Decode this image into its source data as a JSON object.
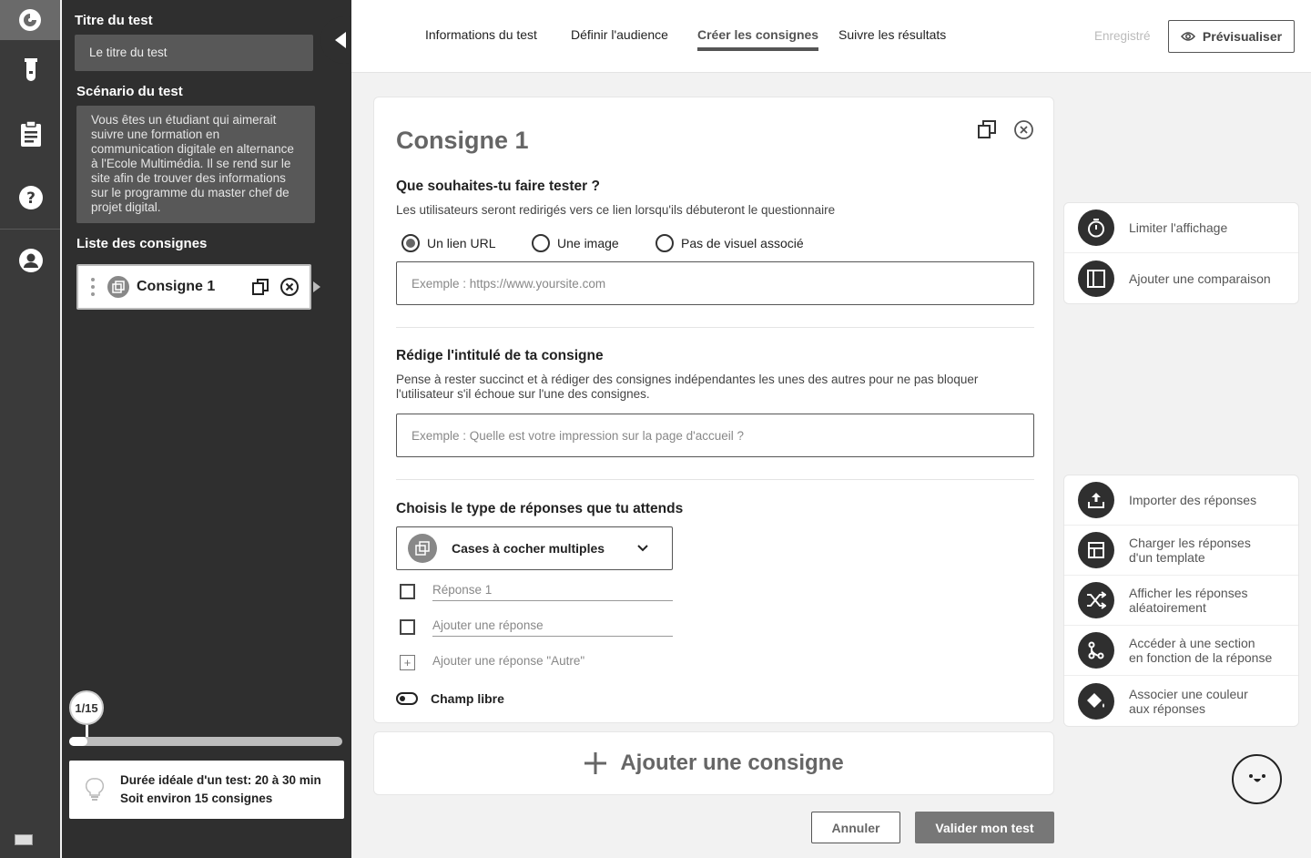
{
  "sidebar": {
    "test_title_heading": "Titre du test",
    "test_title_value": "Le titre du test",
    "scenario_heading": "Scénario du test",
    "scenario_text": "Vous êtes un étudiant qui aimerait suivre une formation en communication digitale en alternance à l'Ecole Multimédia. Il se rend sur le site afin de trouver des informations sur le programme du master chef de projet digital.",
    "list_heading": "Liste des consignes",
    "consignes": [
      {
        "label": "Consigne 1"
      }
    ],
    "progress_label": "1/15",
    "progress_fraction": 0.067,
    "tip_line1": "Durée idéale d'un test: 20 à 30 min",
    "tip_line2": "Soit environ 15 consignes"
  },
  "tabs": [
    {
      "label": "Informations du test"
    },
    {
      "label": "Définir l'audience"
    },
    {
      "label": "Créer les consignes",
      "active": true
    },
    {
      "label": "Suivre les résultats"
    }
  ],
  "header": {
    "saved_label": "Enregistré",
    "preview_label": "Prévisualiser"
  },
  "form": {
    "title": "Consigne 1",
    "q1": "Que souhaites-tu faire tester ?",
    "q1_sub": "Les utilisateurs seront redirigés vers ce lien lorsqu'ils débuteront le questionnaire",
    "radios": [
      {
        "label": "Un lien URL",
        "selected": true
      },
      {
        "label": "Une image",
        "selected": false
      },
      {
        "label": "Pas de visuel associé",
        "selected": false
      }
    ],
    "url_placeholder": "Exemple : https://www.yoursite.com",
    "q2": "Rédige l'intitulé de ta consigne",
    "q2_sub": "Pense à rester succinct et à rédiger des consignes indépendantes les unes des autres pour ne pas bloquer l'utilisateur s'il échoue sur l'une des consignes.",
    "title_placeholder": "Exemple : Quelle est votre impression sur la page d'accueil ?",
    "q3": "Choisis le type de réponses que tu attends",
    "answer_type": "Cases à cocher multiples",
    "answers": [
      "Réponse 1",
      "Ajouter une réponse"
    ],
    "add_other": "Ajouter une réponse \"Autre\"",
    "free_field": "Champ libre"
  },
  "add_consigne": "Ajouter une consigne",
  "buttons": {
    "cancel": "Annuler",
    "validate": "Valider mon test"
  },
  "options_top": [
    {
      "label": "Limiter l'affichage",
      "icon": "timer-icon"
    },
    {
      "label": "Ajouter une comparaison",
      "icon": "split-view-icon"
    }
  ],
  "options_bottom": [
    {
      "label": "Importer des réponses",
      "icon": "upload-icon"
    },
    {
      "label": "Charger les réponses\nd'un template",
      "icon": "template-icon"
    },
    {
      "label": "Afficher les réponses\naléatoirement",
      "icon": "shuffle-icon"
    },
    {
      "label": "Accéder à une section\nen fonction de la réponse",
      "icon": "branch-icon"
    },
    {
      "label": "Associer une couleur\naux réponses",
      "icon": "paint-bucket-icon"
    }
  ]
}
